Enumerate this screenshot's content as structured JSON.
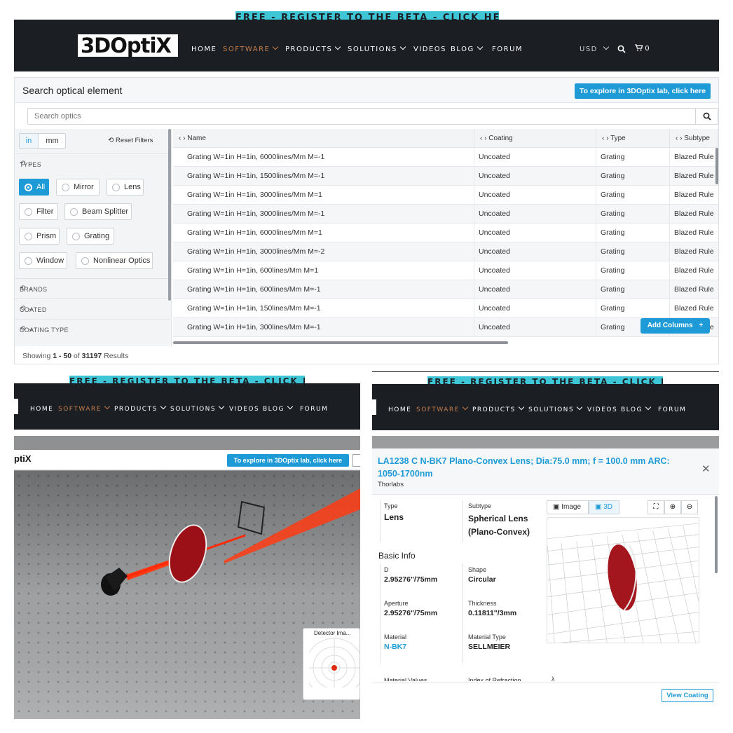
{
  "banner_text": "FREE - REGISTER TO THE BETA - CLICK HERE",
  "logo_text": "3DOptiX",
  "nav": {
    "items": [
      "HOME",
      "SOFTWARE",
      "PRODUCTS",
      "SOLUTIONS",
      "VIDEOS",
      "BLOG",
      "FORUM"
    ],
    "currency": "USD",
    "cart_count": "0"
  },
  "search_panel": {
    "title": "Search optical element",
    "explore_button": "To explore in 3DOptix lab, click here",
    "search_placeholder": "Search optics",
    "units": [
      "in",
      "mm"
    ],
    "reset_filters": "Reset Filters",
    "types_label": "TYPES",
    "types": [
      "All",
      "Mirror",
      "Lens",
      "Filter",
      "Beam Splitter",
      "Prism",
      "Grating",
      "Window",
      "Nonlinear Optics"
    ],
    "selected_type": "All",
    "sections": [
      "BRANDS",
      "COATED",
      "COATING TYPE"
    ],
    "columns": [
      "Name",
      "Coating",
      "Type",
      "Subtype"
    ],
    "rows": [
      [
        "Grating W=1in H=1in, 6000lines/Mm M=-1",
        "Uncoated",
        "Grating",
        "Blazed Rule"
      ],
      [
        "Grating W=1in H=1in, 1500lines/Mm M=-1",
        "Uncoated",
        "Grating",
        "Blazed Rule"
      ],
      [
        "Grating W=1in H=1in, 3000lines/Mm M=1",
        "Uncoated",
        "Grating",
        "Blazed Rule"
      ],
      [
        "Grating W=1in H=1in, 3000lines/Mm M=-1",
        "Uncoated",
        "Grating",
        "Blazed Rule"
      ],
      [
        "Grating W=1in H=1in, 6000lines/Mm M=1",
        "Uncoated",
        "Grating",
        "Blazed Rule"
      ],
      [
        "Grating W=1in H=1in, 3000lines/Mm M=-2",
        "Uncoated",
        "Grating",
        "Blazed Rule"
      ],
      [
        "Grating W=1in H=1in, 600lines/Mm M=1",
        "Uncoated",
        "Grating",
        "Blazed Rule"
      ],
      [
        "Grating W=1in H=1in, 600lines/Mm M=-1",
        "Uncoated",
        "Grating",
        "Blazed Rule"
      ],
      [
        "Grating W=1in H=1in, 150lines/Mm M=-1",
        "Uncoated",
        "Grating",
        "Blazed Rule"
      ],
      [
        "Grating W=1in H=1in, 300lines/Mm M=-1",
        "Uncoated",
        "Grating",
        "Blazed Rule"
      ]
    ],
    "add_columns": "Add Columns",
    "showing_prefix": "Showing ",
    "showing_range": "1 - 50",
    "showing_of": " of ",
    "showing_total": "31197",
    "showing_suffix": " Results"
  },
  "lab_panel": {
    "logo_partial": "ptiX",
    "explore_button": "To explore in 3DOptix lab, click here",
    "detector_title": "Detector Ima..."
  },
  "detail_panel": {
    "title": "LA1238 C N-BK7 Plano-Convex Lens; Dia:75.0 mm; f = 100.0 mm ARC: 1050-1700nm",
    "brand": "Thorlabs",
    "type_label": "Type",
    "type_value": "Lens",
    "subtype_label": "Subtype",
    "subtype_value": "Spherical Lens (Plano-Convex)",
    "basic_info": "Basic Info",
    "d_label": "D",
    "d_value": "2.95276\"/75mm",
    "shape_label": "Shape",
    "shape_value": "Circular",
    "aperture_label": "Aperture",
    "aperture_value": "2.95276\"/75mm",
    "thickness_label": "Thickness",
    "thickness_value": "0.11811\"/3mm",
    "material_label": "Material",
    "material_value": "N-BK7",
    "material_type_label": "Material Type",
    "material_type_value": "SELLMEIER",
    "material_values_label": "Material Values",
    "index_label": "Index of Refraction",
    "lambda_symbol": "λ",
    "image_tab": "Image",
    "three_d_tab": "3D",
    "view_coating": "View Coating"
  },
  "colors": {
    "navbar": "#1b1e23",
    "banner": "#3fc6d6",
    "accent_blue": "#1e9bd7",
    "active_nav": "#c47e4d",
    "lens_red": "#a3161d",
    "beam": "#ff3b14"
  }
}
